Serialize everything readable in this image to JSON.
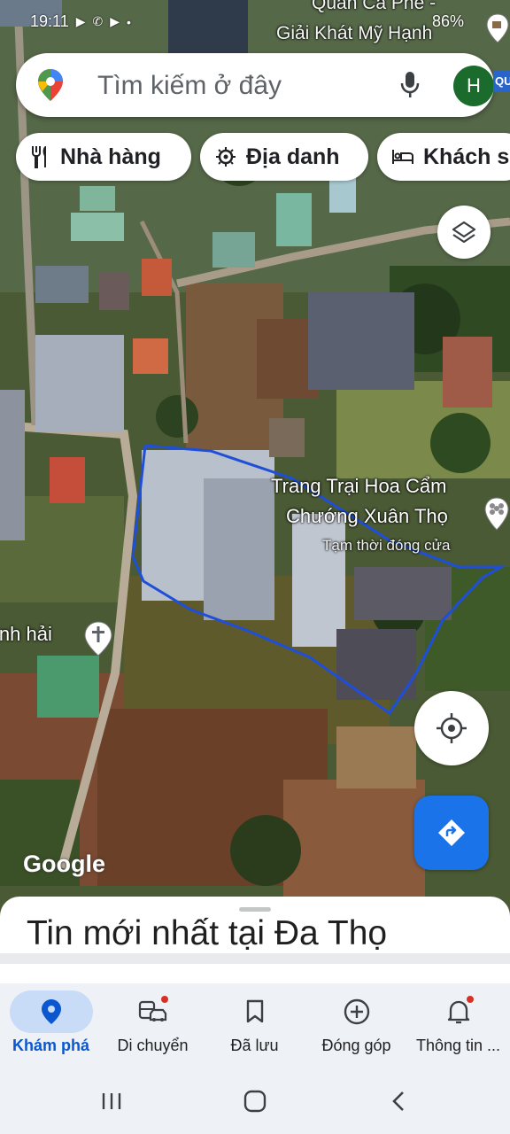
{
  "status_bar": {
    "time": "19:11",
    "battery": "86%"
  },
  "search": {
    "placeholder": "Tìm kiếm ở đây",
    "avatar_initial": "H",
    "edge_tag": "QU"
  },
  "chips": [
    {
      "label": "Nhà hàng",
      "icon": "fork-knife-icon"
    },
    {
      "label": "Địa danh",
      "icon": "landmark-icon"
    },
    {
      "label": "Khách sạn",
      "icon": "bed-icon"
    }
  ],
  "map": {
    "poi": {
      "name_line1": "Trang Trại Hoa Cẩm",
      "name_line2": "Chướng Xuân Thọ",
      "status": "Tạm thời đóng cửa"
    },
    "church_label": "inh hải",
    "shop_label_line1": "Quán Cà Phê -",
    "shop_label_line2": "Giải Khát Mỹ Hạnh",
    "logo": "Google",
    "outline_color": "#1f4fd8"
  },
  "sheet": {
    "title": "Tin mới nhất tại Đa Thọ"
  },
  "nav": [
    {
      "label": "Khám phá",
      "icon": "explore-pin-icon",
      "active": true
    },
    {
      "label": "Di chuyển",
      "icon": "commute-icon",
      "active": false
    },
    {
      "label": "Đã lưu",
      "icon": "bookmark-icon",
      "active": false
    },
    {
      "label": "Đóng góp",
      "icon": "add-circle-icon",
      "active": false
    },
    {
      "label": "Thông tin ...",
      "icon": "bell-icon",
      "active": false
    }
  ],
  "colors": {
    "accent": "#1a73e8",
    "active_nav_bg": "#c8dbf7",
    "badge": "#d93025"
  }
}
